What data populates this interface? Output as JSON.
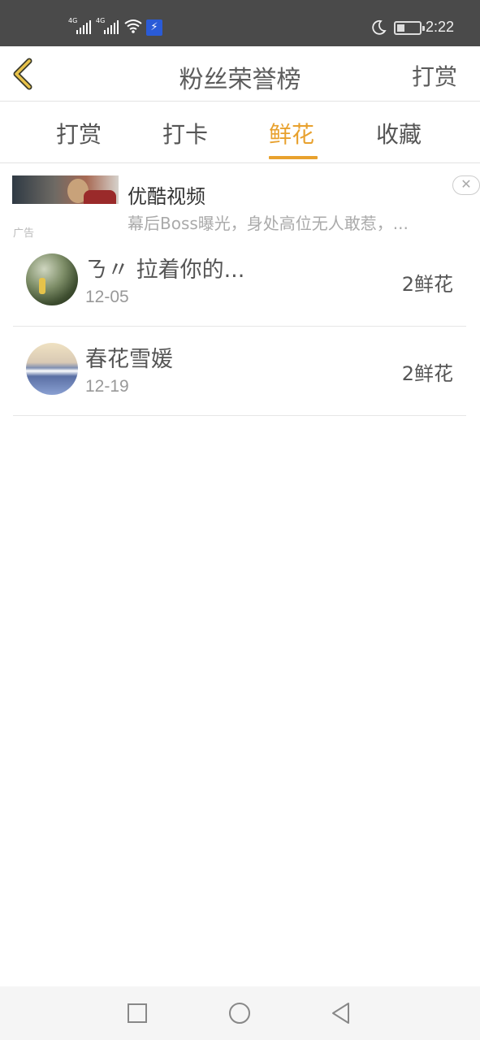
{
  "status_bar": {
    "signal_1": "4G",
    "signal_2": "4G",
    "charge_icon": "⚡",
    "time": "2:22",
    "icons": [
      "signal-icon",
      "signal-icon",
      "wifi-icon",
      "charging-icon",
      "moon-icon",
      "battery-icon"
    ]
  },
  "header": {
    "title": "粉丝荣誉榜",
    "action_label": "打赏",
    "back_icon": "chevron-left-icon"
  },
  "tabs": [
    {
      "label": "打赏",
      "active": false
    },
    {
      "label": "打卡",
      "active": false
    },
    {
      "label": "鲜花",
      "active": true
    },
    {
      "label": "收藏",
      "active": false
    }
  ],
  "ad": {
    "brand": "优酷视频",
    "description": "幕后Boss曝光，身处高位无人敢惹，...",
    "label": "广告",
    "close_glyph": "✕"
  },
  "list": [
    {
      "name": "ㄋ〃 拉着你的...",
      "date": "12-05",
      "amount": "2鲜花"
    },
    {
      "name": "春花雪媛",
      "date": "12-19",
      "amount": "2鲜花"
    }
  ],
  "colors": {
    "accent": "#e8a12e",
    "status_bar_bg": "#4a4a4a",
    "text": "#555555"
  },
  "nav": {
    "icons": [
      "square-icon",
      "circle-icon",
      "back-triangle-icon"
    ]
  }
}
